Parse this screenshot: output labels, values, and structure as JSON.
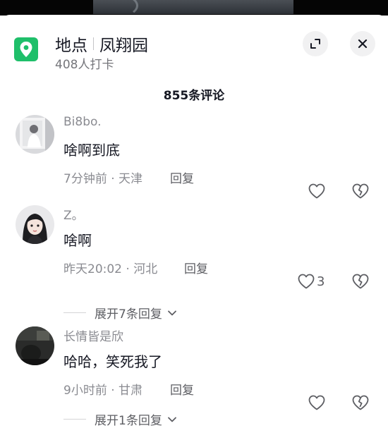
{
  "location": {
    "kind_label": "地点",
    "name": "凤翔园",
    "checkins": "408人打卡",
    "icon": "location-pin-icon",
    "icon_color": "#1fbf6a"
  },
  "header": {
    "comment_count_title": "855条评论"
  },
  "comments": [
    {
      "username": "Bi8bo.",
      "text": "啥啊到底",
      "time_location": "7分钟前 · 天津",
      "reply_label": "回复",
      "like_count": ""
    },
    {
      "username": "Z。",
      "text": "啥啊",
      "time_location": "昨天20:02 · 河北",
      "reply_label": "回复",
      "like_count": "3",
      "expand_label": "展开7条回复"
    },
    {
      "username": "长情皆是欣",
      "text": "哈哈，笑死我了",
      "time_location": "9小时前 · 甘肃",
      "reply_label": "回复",
      "like_count": "",
      "expand_label": "展开1条回复"
    }
  ]
}
